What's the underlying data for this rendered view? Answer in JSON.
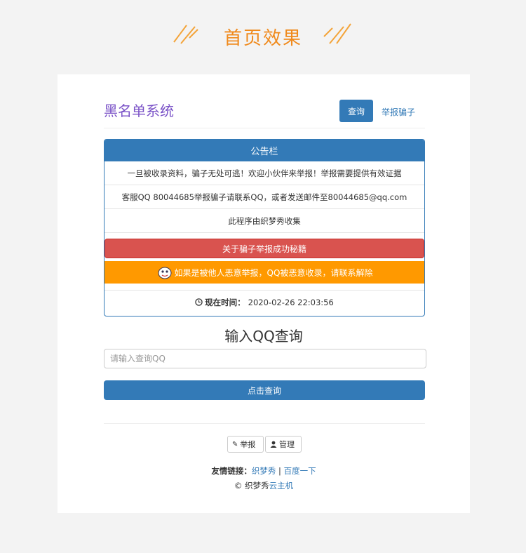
{
  "banner": {
    "title": "首页效果",
    "accent": "#f08a1c"
  },
  "header": {
    "brand": "黑名单系统",
    "nav_active": "查询",
    "nav_report": "举报骗子"
  },
  "notice": {
    "heading": "公告栏",
    "line1": "一旦被收录资料，骗子无处可逃！欢迎小伙伴来举报！举报需要提供有效证据",
    "line2": "客服QQ 80044685举报骗子请联系QQ，或者发送邮件至80044685@qq.com",
    "line3": "此程序由织梦秀收集",
    "tips_button": "关于骗子举报成功秘籍",
    "warning": "如果是被他人恶意举报，QQ被恶意收录，请联系解除",
    "time_label": "现在时间：",
    "time_value": "2020-02-26 22:03:56"
  },
  "query": {
    "title": "输入QQ查询",
    "placeholder": "请输入查询QQ",
    "button": "点击查询"
  },
  "footer": {
    "report_button": "举报",
    "admin_button": "管理",
    "links_label": "友情链接：",
    "link1": "织梦秀",
    "separator": " | ",
    "link2": "百度一下",
    "copy_prefix": "© 织梦秀",
    "copy_link": "云主机"
  },
  "colors": {
    "primary": "#337ab7",
    "danger": "#d9534f",
    "warning": "#ff9900",
    "brand": "#7a52c7"
  }
}
